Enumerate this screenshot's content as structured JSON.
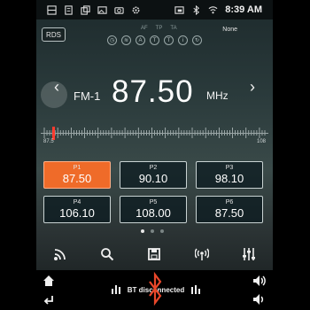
{
  "status_bar": {
    "time": "8:39 AM",
    "left_icons": [
      "window-icon",
      "notes-icon",
      "copy-icon",
      "image-icon",
      "camera-icon",
      "gear-icon"
    ],
    "right_icons": [
      "cast-icon",
      "bluetooth-icon",
      "wifi-icon"
    ]
  },
  "rds": {
    "button_label": "RDS",
    "pty_label": "None"
  },
  "flags": [
    "AF",
    "TP",
    "TA"
  ],
  "tuner": {
    "band": "FM-1",
    "frequency": "87.50",
    "unit": "MHz",
    "scale_min": "87.5",
    "scale_max": "108"
  },
  "presets": [
    {
      "name": "P1",
      "freq": "87.50",
      "active": true
    },
    {
      "name": "P2",
      "freq": "90.10",
      "active": false
    },
    {
      "name": "P3",
      "freq": "98.10",
      "active": false
    },
    {
      "name": "P4",
      "freq": "106.10",
      "active": false
    },
    {
      "name": "P5",
      "freq": "108.00",
      "active": false
    },
    {
      "name": "P6",
      "freq": "87.50",
      "active": false
    }
  ],
  "page_dots": {
    "count": 3,
    "active_index": 0
  },
  "toolbar": [
    "broadcast-icon",
    "search-icon",
    "save-icon",
    "radio-antenna-icon",
    "equalizer-icon"
  ],
  "bottom_bar": {
    "bt_status": "BT disconnected"
  },
  "colors": {
    "accent": "#ef6b29",
    "needle": "#ff3b2f"
  }
}
